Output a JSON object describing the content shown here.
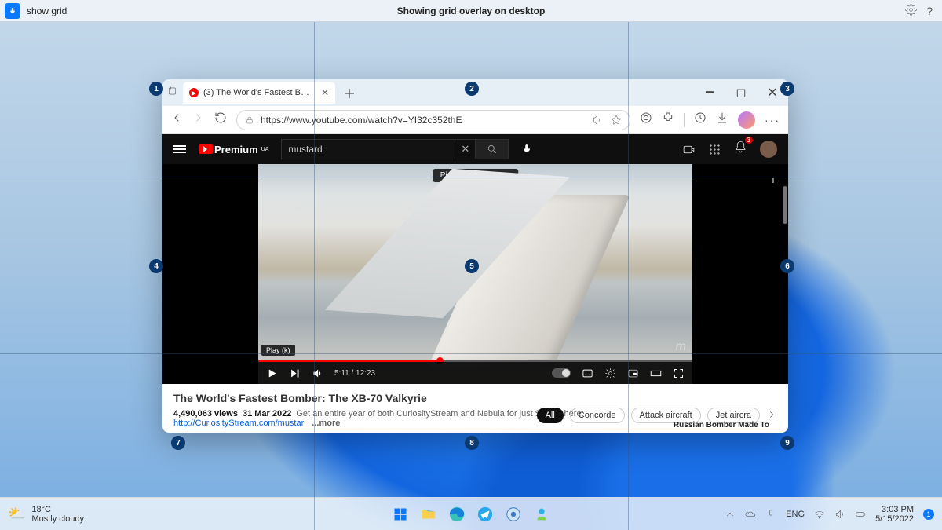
{
  "voicebar": {
    "command": "show grid",
    "status": "Showing grid overlay on desktop"
  },
  "grid": {
    "numbers": [
      "1",
      "2",
      "3",
      "4",
      "5",
      "6",
      "7",
      "8",
      "9"
    ]
  },
  "browser": {
    "tab_title": "(3) The World's Fastest Bomber:",
    "url": "https://www.youtube.com/watch?v=YI32c352thE"
  },
  "youtube": {
    "logo_text": "Premium",
    "logo_region": "UA",
    "search_value": "mustard",
    "notif_count": "3",
    "pip_label": "Picture in picture",
    "play_hint": "Play (k)",
    "watermark": "m",
    "time": "5:11 / 12:23",
    "title": "The World's Fastest Bomber: The XB-70 Valkyrie",
    "views": "4,490,063 views",
    "date": "31 Mar 2022",
    "desc_a": "Get an entire year of both CuriosityStream and Nebula for just $14.79 here:",
    "desc_link": "http://CuriosityStream.com/mustar",
    "more": "...more",
    "chips": [
      "All",
      "Concorde",
      "Attack aircraft",
      "Jet aircra"
    ],
    "related": "Russian Bomber Made To"
  },
  "taskbar": {
    "temp": "18°C",
    "cond": "Mostly cloudy",
    "lang": "ENG",
    "time": "3:03 PM",
    "date": "5/15/2022",
    "notif": "1"
  }
}
